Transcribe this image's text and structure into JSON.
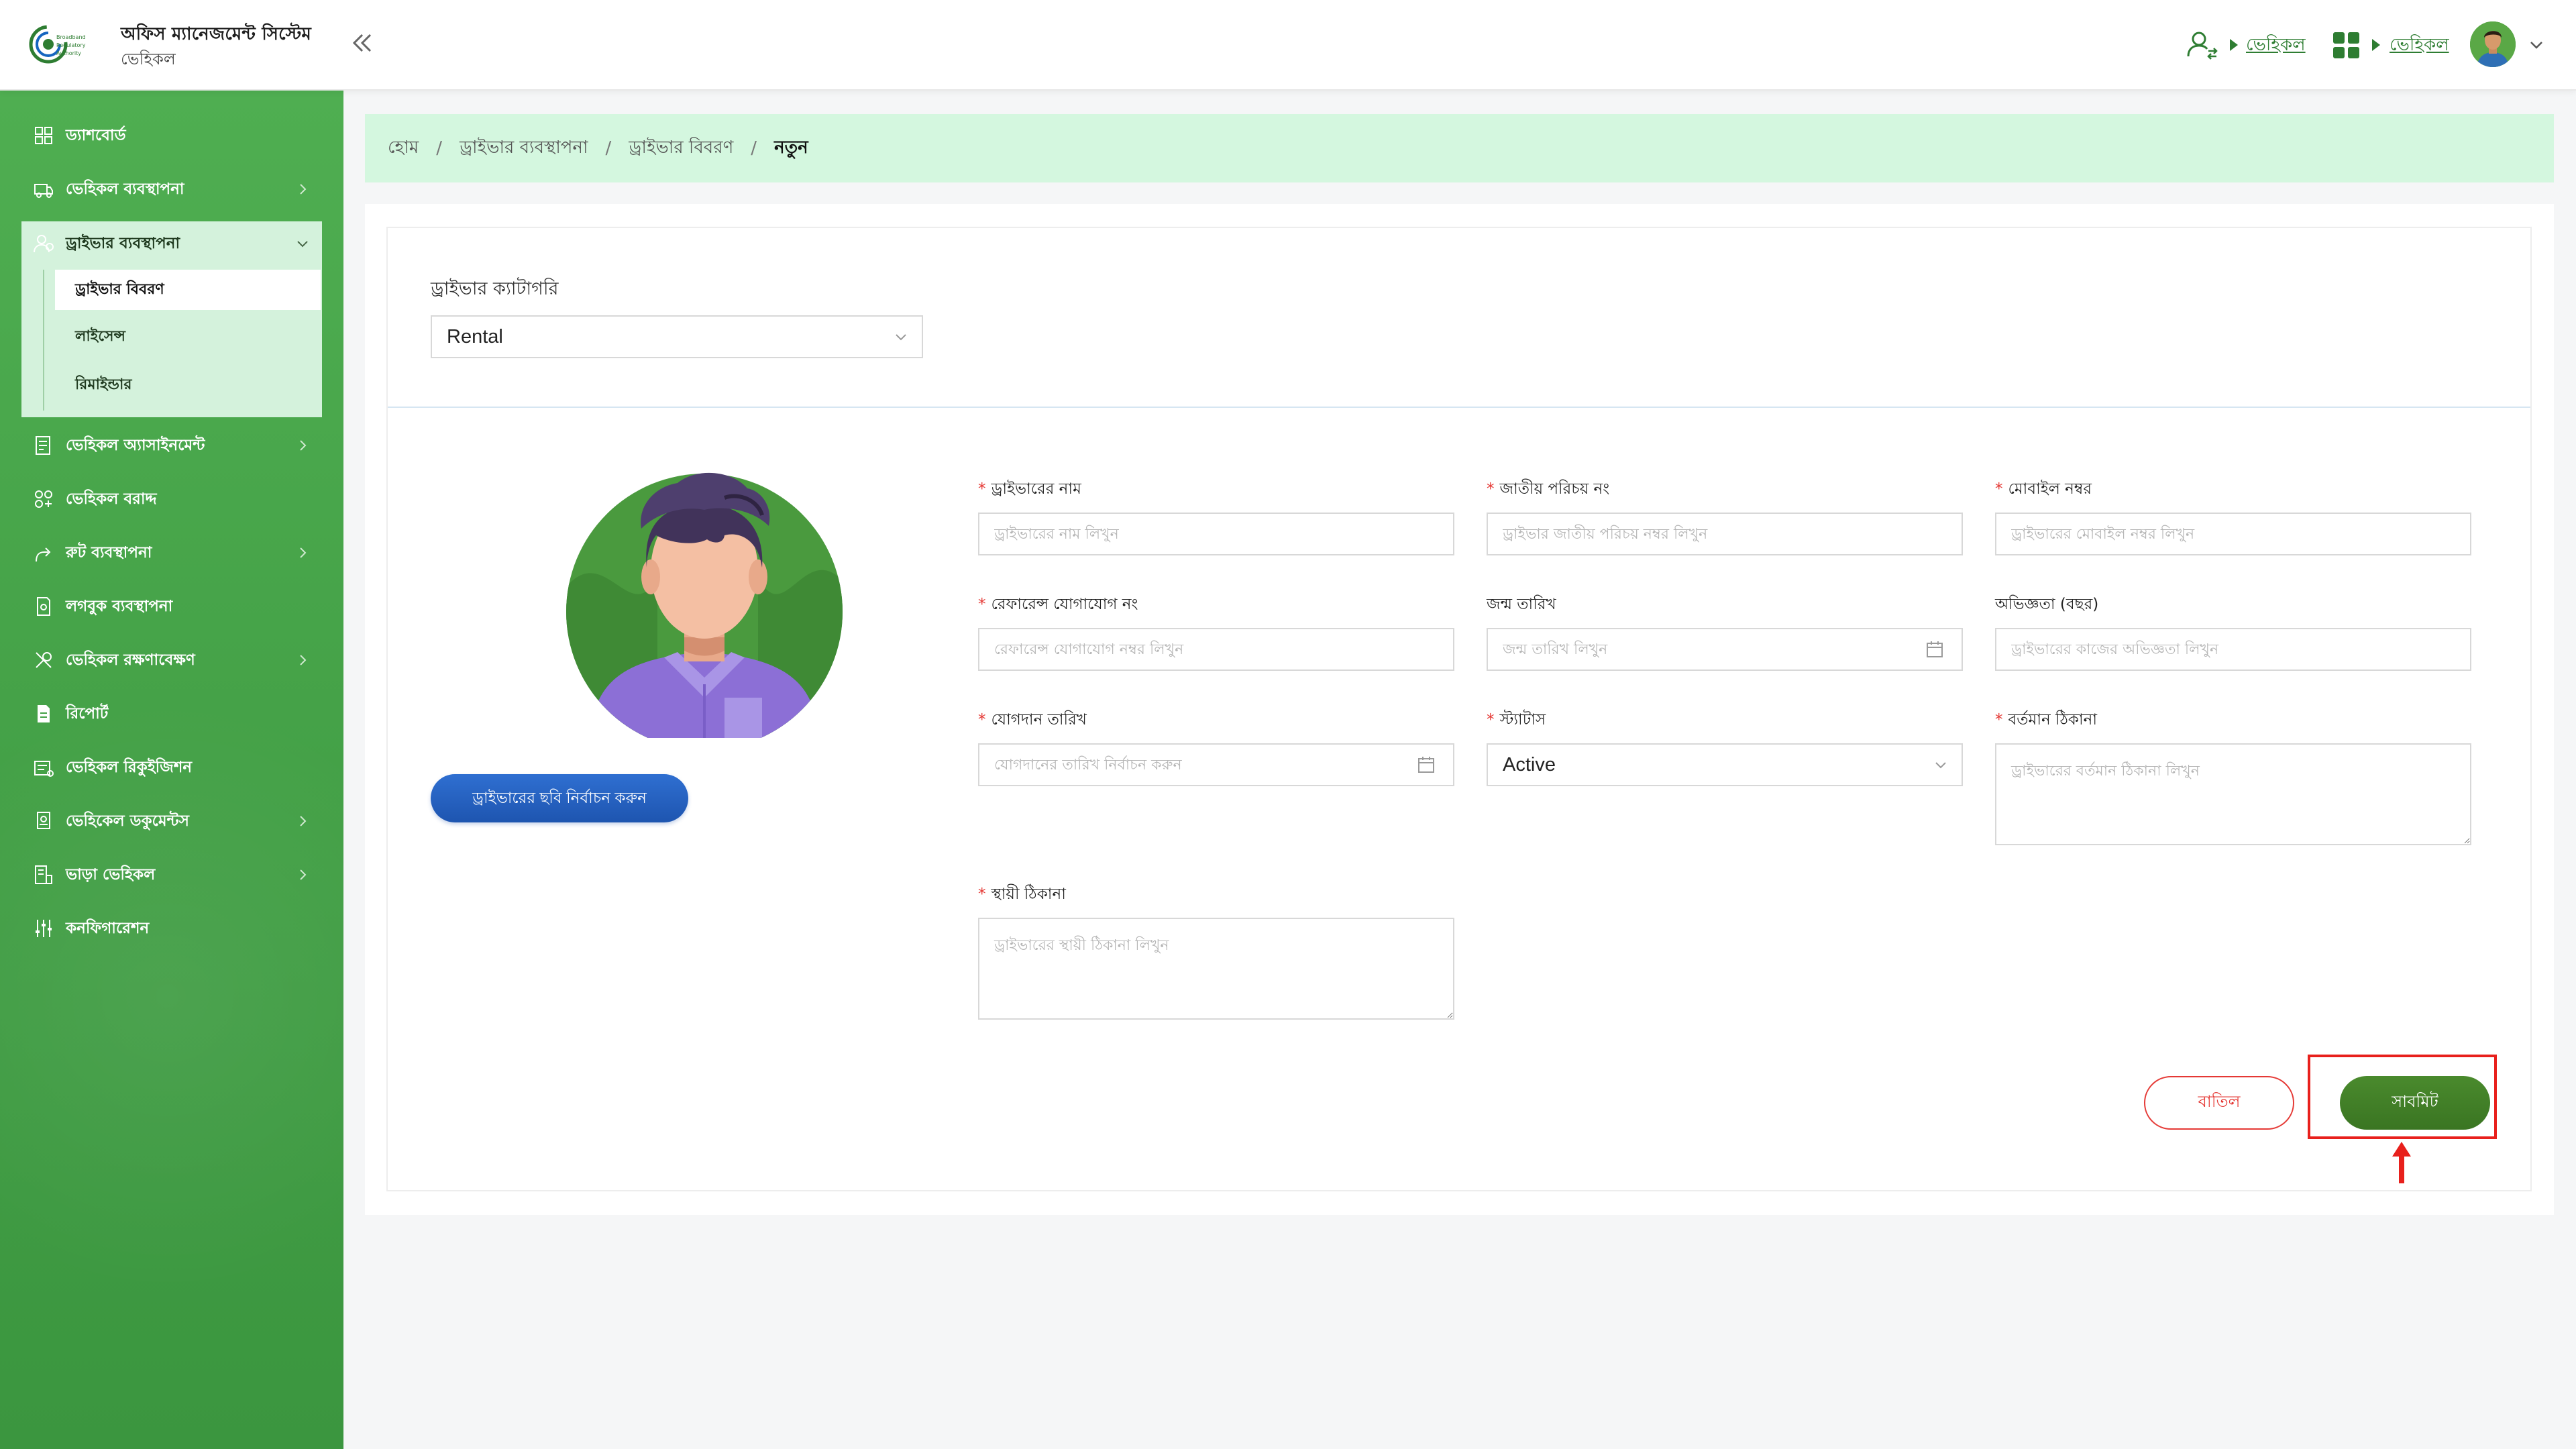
{
  "header": {
    "app_title": "অফিস ম্যানেজমেন্ট সিস্টেম",
    "app_subtitle": "ভেহিকল",
    "logo_text": "Broadband Regulatory Authority",
    "link_user_module": "ভেহিকল",
    "link_apps_module": "ভেহিকল",
    "icons": [
      "user-switch-icon",
      "apps-grid-icon",
      "avatar",
      "chevron-down-icon",
      "double-chevron-left-icon"
    ]
  },
  "sidebar": {
    "items": [
      {
        "label": "ড্যাশবোর্ড",
        "icon": "dashboard-icon",
        "has_children": false
      },
      {
        "label": "ভেহিকল ব্যবস্থাপনা",
        "icon": "vehicle-icon",
        "has_children": true
      },
      {
        "label": "ড্রাইভার ব্যবস্থাপনা",
        "icon": "driver-icon",
        "has_children": true,
        "expanded": true,
        "children": [
          "ড্রাইভার বিবরণ",
          "লাইসেন্স",
          "রিমাইন্ডার"
        ],
        "active_child": 0
      },
      {
        "label": "ভেহিকল অ্যাসাইনমেন্ট",
        "icon": "assignment-icon",
        "has_children": true
      },
      {
        "label": "ভেহিকল বরাদ্দ",
        "icon": "allocation-icon",
        "has_children": false
      },
      {
        "label": "রুট ব্যবস্থাপনা",
        "icon": "route-icon",
        "has_children": true
      },
      {
        "label": "লগবুক ব্যবস্থাপনা",
        "icon": "logbook-icon",
        "has_children": false
      },
      {
        "label": "ভেহিকল রক্ষণাবেক্ষণ",
        "icon": "maintenance-icon",
        "has_children": true
      },
      {
        "label": "রিপোর্ট",
        "icon": "report-icon",
        "has_children": false
      },
      {
        "label": "ভেহিকল রিকুইজিশন",
        "icon": "requisition-icon",
        "has_children": false
      },
      {
        "label": "ভেহিকেল ডকুমেন্টস",
        "icon": "documents-icon",
        "has_children": true
      },
      {
        "label": "ভাড়া ভেহিকল",
        "icon": "rental-icon",
        "has_children": true
      },
      {
        "label": "কনফিগারেশন",
        "icon": "config-icon",
        "has_children": false
      }
    ]
  },
  "breadcrumb": {
    "items": [
      "হোম",
      "ড্রাইভার ব্যবস্থাপনা",
      "ড্রাইভার বিবরণ"
    ],
    "current": "নতুন",
    "separator": "/"
  },
  "form": {
    "category_label": "ড্রাইভার ক্যাটাগরি",
    "category_value": "Rental",
    "choose_photo_label": "ড্রাইভারের ছবি নির্বাচন করুন",
    "fields": {
      "driver_name": {
        "label": "ড্রাইভারের নাম",
        "placeholder": "ড্রাইভারের নাম লিখুন",
        "required": true
      },
      "nid": {
        "label": "জাতীয় পরিচয় নং",
        "placeholder": "ড্রাইভার জাতীয় পরিচয় নম্বর লিখুন",
        "required": true
      },
      "mobile": {
        "label": "মোবাইল নম্বর",
        "placeholder": "ড্রাইভারের মোবাইল নম্বর লিখুন",
        "required": true
      },
      "reference_contact": {
        "label": "রেফারেন্স যোগাযোগ নং",
        "placeholder": "রেফারেন্স যোগাযোগ নম্বর লিখুন",
        "required": true
      },
      "dob": {
        "label": "জন্ম তারিখ",
        "placeholder": "জন্ম তারিখ লিখুন",
        "required": false
      },
      "experience": {
        "label": "অভিজ্ঞতা (বছর)",
        "placeholder": "ড্রাইভারের কাজের অভিজ্ঞতা লিখুন",
        "required": false
      },
      "joining_date": {
        "label": "যোগদান তারিখ",
        "placeholder": "যোগদানের তারিখ নির্বাচন করুন",
        "required": true
      },
      "status": {
        "label": "স্ট্যাটাস",
        "value": "Active",
        "required": true
      },
      "present_address": {
        "label": "বর্তমান ঠিকানা",
        "placeholder": "ড্রাইভারের বর্তমান ঠিকানা লিখুন",
        "required": true
      },
      "permanent_address": {
        "label": "স্থায়ী ঠিকানা",
        "placeholder": "ড্রাইভারের স্থায়ী ঠিকানা লিখুন",
        "required": true
      }
    },
    "required_mark": "*",
    "cancel_label": "বাতিল",
    "submit_label": "সাবমিট"
  },
  "colors": {
    "sidebar_green": "#44a147",
    "breadcrumb_bg": "#d4f7df",
    "submit_green": "#3f7d26",
    "cancel_red": "#e53935",
    "photo_button_blue": "#2563c4",
    "highlight_red": "#e8201c"
  }
}
